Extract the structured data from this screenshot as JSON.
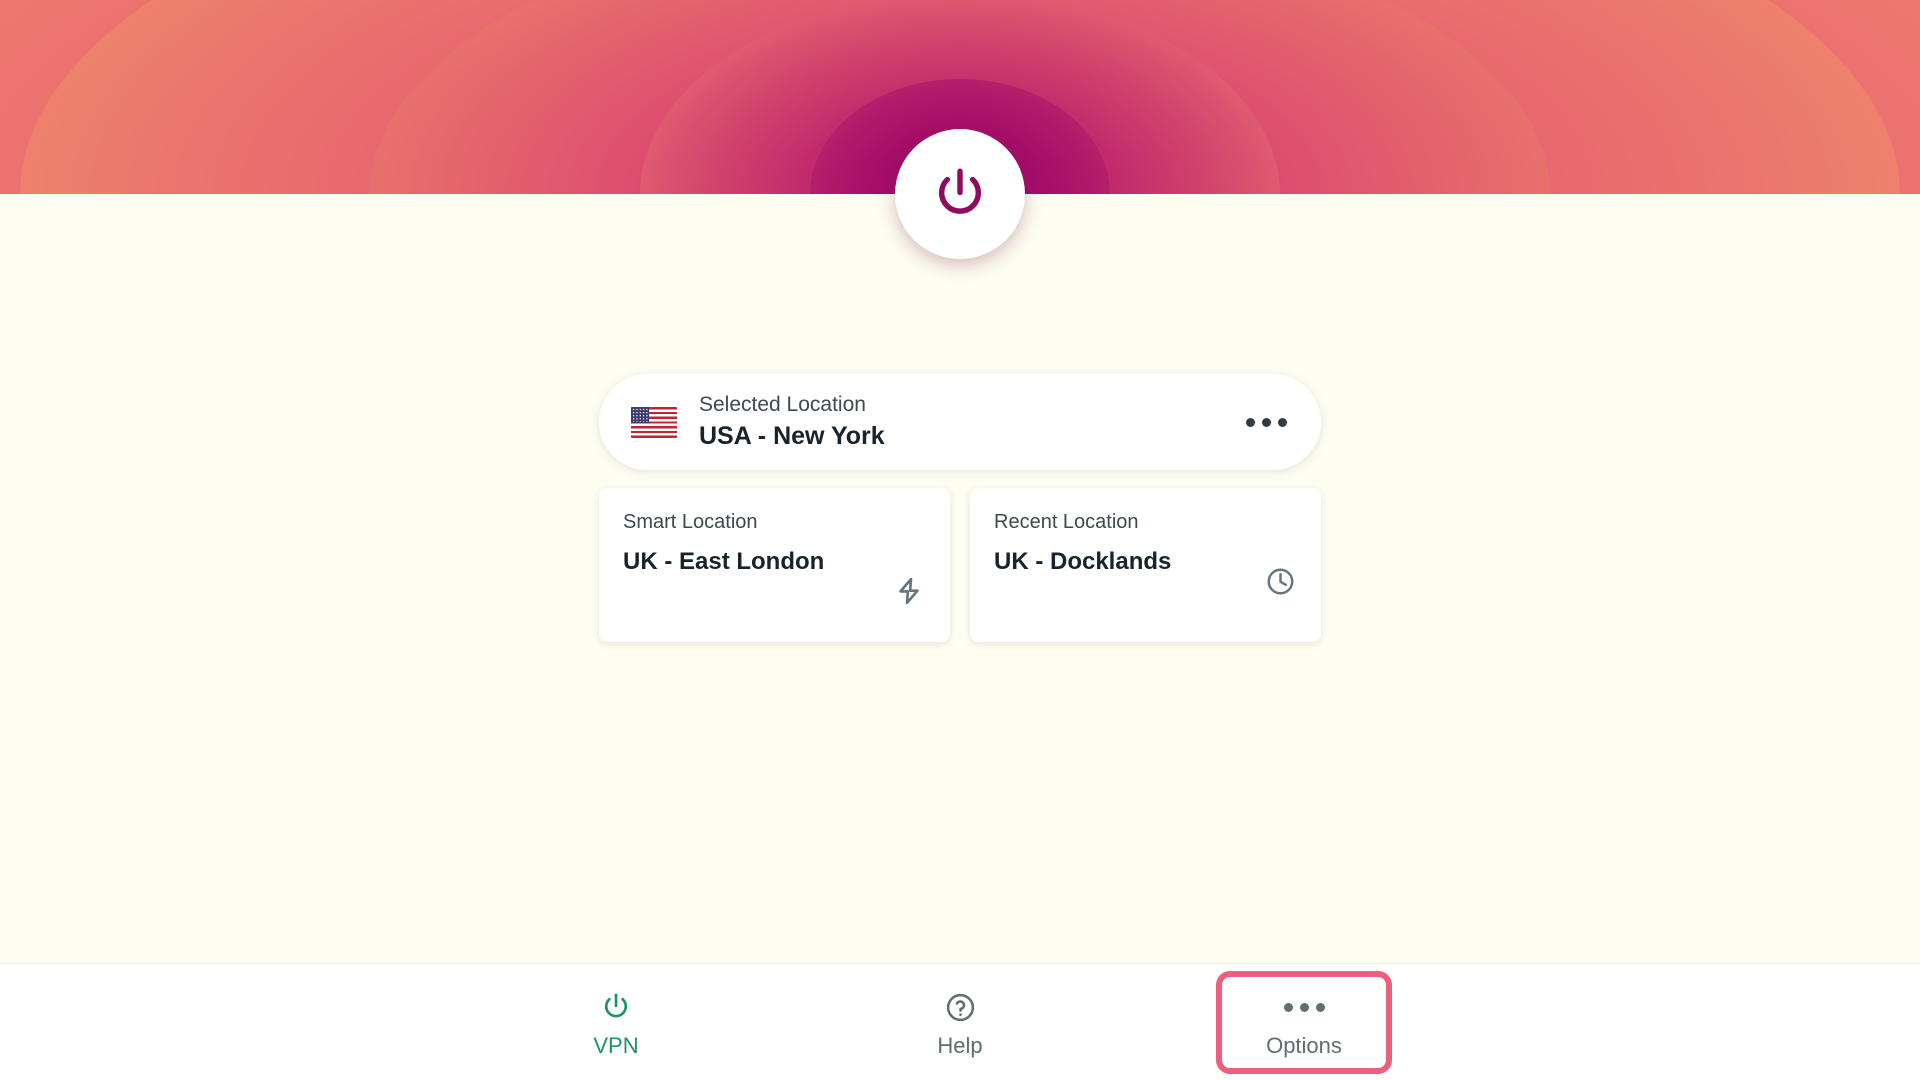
{
  "banner": {
    "accent_center": "#93046B",
    "accent_outer": "#F6A765"
  },
  "power_button": {
    "name": "power-toggle",
    "icon": "power-icon",
    "icon_color": "#8E0B5E"
  },
  "selected_location": {
    "label": "Selected Location",
    "value": "USA - New York",
    "flag": "us-flag-icon",
    "menu_icon": "ellipsis-icon"
  },
  "quick_cards": [
    {
      "label": "Smart Location",
      "value": "UK - East London",
      "icon": "lightning-bolt-icon",
      "icon_color": "#64757F"
    },
    {
      "label": "Recent Location",
      "value": "UK - Docklands",
      "icon": "clock-icon",
      "icon_color": "#64757F"
    }
  ],
  "bottom_nav": {
    "items": [
      {
        "label": "VPN",
        "icon": "power-icon",
        "state": "active",
        "color": "#1E9268"
      },
      {
        "label": "Help",
        "icon": "question-circle-icon",
        "state": "plain",
        "color": "#5F6E6E"
      },
      {
        "label": "Options",
        "icon": "ellipsis-icon",
        "state": "highlighted",
        "color": "#5F6E6E"
      }
    ],
    "highlight_color": "#EC5F7E"
  }
}
